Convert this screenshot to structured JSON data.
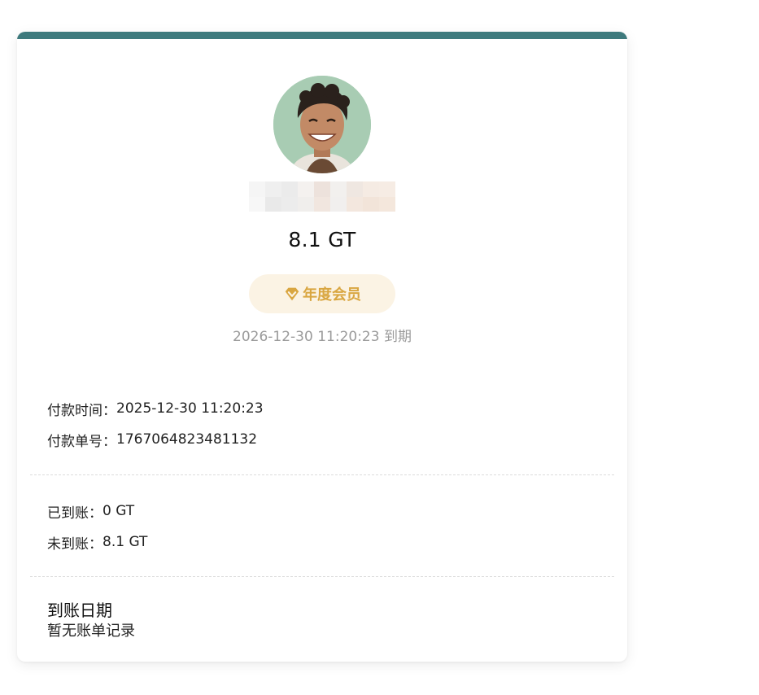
{
  "profile": {
    "avatar_alt": "user avatar",
    "amount": "8.1 GT",
    "membership_label": "年度会员",
    "expire_text": "2026-12-30 11:20:23 到期"
  },
  "payment": {
    "time_label": "付款时间：",
    "time_value": "2025-12-30 11:20:23",
    "order_label": "付款单号：",
    "order_value": "1767064823481132"
  },
  "balance": {
    "received_label": "已到账：",
    "received_value": "0 GT",
    "pending_label": "未到账：",
    "pending_value": "8.1 GT"
  },
  "arrival": {
    "title": "到账日期",
    "empty_text": "暂无账单记录"
  },
  "colors": {
    "accent_bar": "#3e7a7d",
    "badge_bg": "#fbf3e4",
    "badge_text": "#d9a641",
    "muted_text": "#9a9a9a"
  },
  "icons": {
    "membership": "diamond-icon"
  }
}
